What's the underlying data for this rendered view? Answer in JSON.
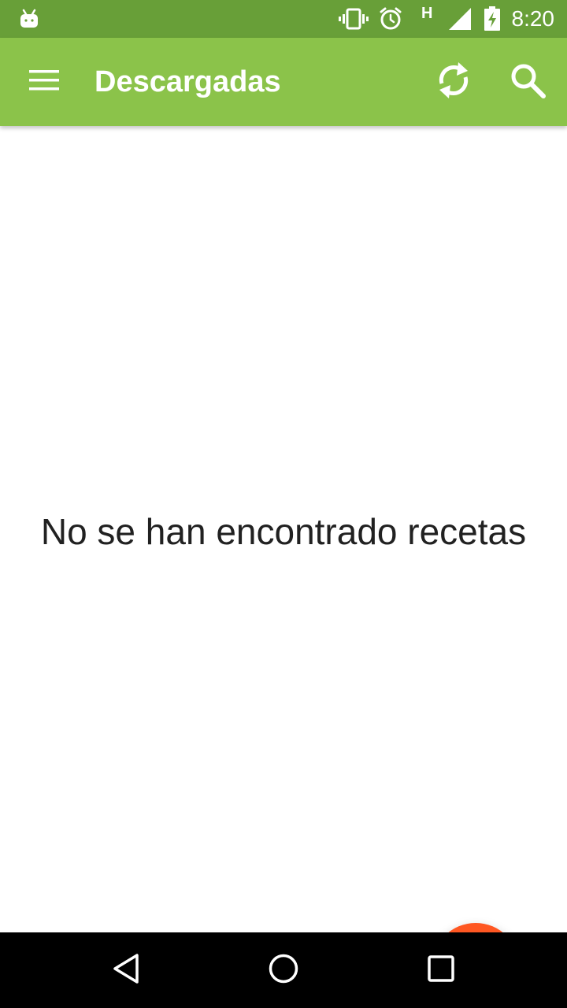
{
  "status_bar": {
    "time": "8:20",
    "network_type": "H",
    "icons": [
      "android-debug-icon",
      "vibrate-icon",
      "alarm-icon",
      "signal-icon",
      "battery-charging-icon"
    ]
  },
  "app_bar": {
    "title": "Descargadas",
    "menu_icon": "menu-icon",
    "refresh_icon": "refresh-icon",
    "search_icon": "search-icon"
  },
  "content": {
    "empty_message": "No se han encontrado recetas"
  },
  "fab": {
    "icon": "plus-icon"
  },
  "nav_bar": {
    "buttons": [
      "back-icon",
      "home-icon",
      "recents-icon"
    ]
  },
  "colors": {
    "status_bar": "#689f38",
    "app_bar": "#8bc34a",
    "fab": "#ff5722",
    "text_primary": "#212121",
    "nav_bar": "#000000"
  }
}
